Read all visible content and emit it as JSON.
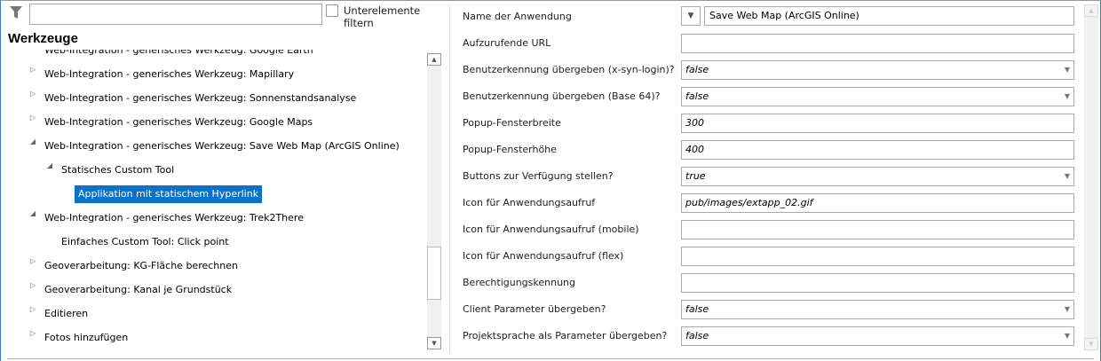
{
  "filter": {
    "search_value": "",
    "checkbox_label": "Unterelemente filtern",
    "checked": false
  },
  "tree": {
    "title": "Werkzeuge",
    "items": [
      {
        "label": "Web-Integration - generisches Werkzeug: Google Earth",
        "level": 0,
        "state": "collapsed"
      },
      {
        "label": "Web-Integration - generisches Werkzeug: Mapillary",
        "level": 0,
        "state": "collapsed"
      },
      {
        "label": "Web-Integration - generisches Werkzeug: Sonnenstandsanalyse",
        "level": 0,
        "state": "collapsed"
      },
      {
        "label": "Web-Integration - generisches Werkzeug: Google Maps",
        "level": 0,
        "state": "collapsed"
      },
      {
        "label": "Web-Integration - generisches Werkzeug: Save Web Map (ArcGIS Online)",
        "level": 0,
        "state": "expanded"
      },
      {
        "label": "Statisches Custom Tool",
        "level": 1,
        "state": "expanded"
      },
      {
        "label": "Applikation mit statischem Hyperlink",
        "level": 2,
        "state": "leaf",
        "selected": true
      },
      {
        "label": "Web-Integration - generisches Werkzeug: Trek2There",
        "level": 0,
        "state": "expanded"
      },
      {
        "label": "Einfaches Custom Tool: Click point",
        "level": 1,
        "state": "leaf"
      },
      {
        "label": "Geoverarbeitung: KG-Fläche berechnen",
        "level": 0,
        "state": "collapsed"
      },
      {
        "label": "Geoverarbeitung: Kanal je Grundstück",
        "level": 0,
        "state": "collapsed"
      },
      {
        "label": "Editieren",
        "level": 0,
        "state": "collapsed"
      },
      {
        "label": "Fotos hinzufügen",
        "level": 0,
        "state": "collapsed"
      }
    ]
  },
  "properties": [
    {
      "label": "Name der Anwendung",
      "value": "Save Web Map (ArcGIS Online)",
      "type": "name"
    },
    {
      "label": "Aufzurufende URL",
      "value": "",
      "type": "text"
    },
    {
      "label": "Benutzerkennung übergeben (x-syn-login)?",
      "value": "false",
      "type": "select"
    },
    {
      "label": "Benutzerkennung übergeben (Base 64)?",
      "value": "false",
      "type": "select"
    },
    {
      "label": "Popup-Fensterbreite",
      "value": "300",
      "type": "text"
    },
    {
      "label": "Popup-Fensterhöhe",
      "value": "400",
      "type": "text"
    },
    {
      "label": "Buttons zur Verfügung stellen?",
      "value": "true",
      "type": "select"
    },
    {
      "label": "Icon für Anwendungsaufruf",
      "value": "pub/images/extapp_02.gif",
      "type": "text"
    },
    {
      "label": "Icon für Anwendungsaufruf (mobile)",
      "value": "",
      "type": "text"
    },
    {
      "label": "Icon für Anwendungsaufruf (flex)",
      "value": "",
      "type": "text"
    },
    {
      "label": "Berechtigungskennung",
      "value": "",
      "type": "text"
    },
    {
      "label": "Client Parameter übergeben?",
      "value": "false",
      "type": "select"
    },
    {
      "label": "Projektsprache als Parameter übergeben?",
      "value": "false",
      "type": "select"
    }
  ],
  "colors": {
    "selection": "#0a72c8",
    "frame": "#3a7fc4"
  }
}
